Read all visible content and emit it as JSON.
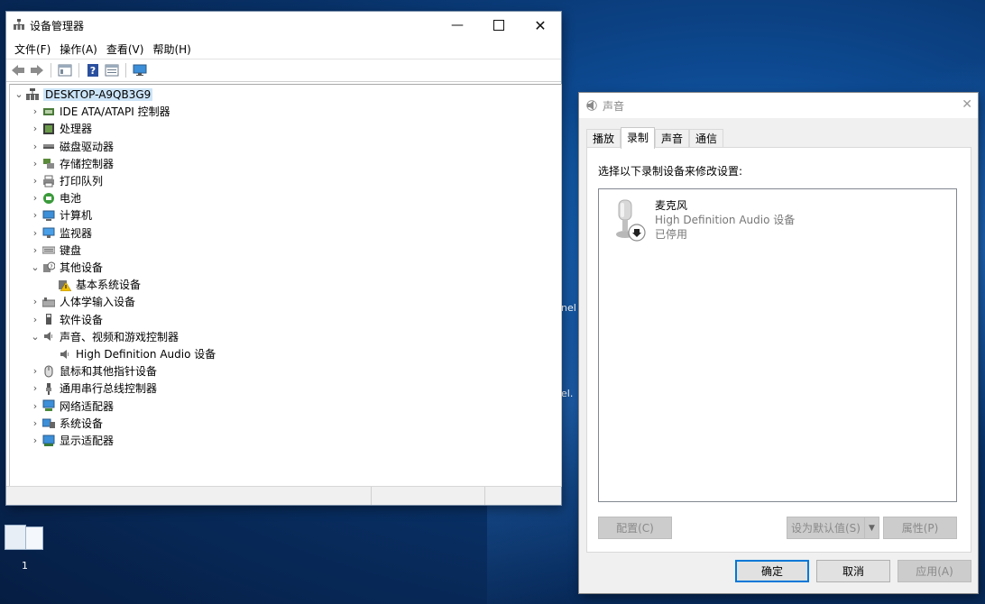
{
  "desktop": {
    "edge_text_1": "nel",
    "edge_text_2": "el.",
    "thumbnail_number": "1"
  },
  "device_manager": {
    "title": "设备管理器",
    "menu": [
      "文件(F)",
      "操作(A)",
      "查看(V)",
      "帮助(H)"
    ],
    "root": "DESKTOP-A9QB3G9",
    "tree": [
      {
        "label": "IDE ATA/ATAPI 控制器",
        "icon": "ide-controller-icon",
        "expanded": false,
        "level": 1
      },
      {
        "label": "处理器",
        "icon": "processor-icon",
        "expanded": false,
        "level": 1
      },
      {
        "label": "磁盘驱动器",
        "icon": "disk-drive-icon",
        "expanded": false,
        "level": 1
      },
      {
        "label": "存储控制器",
        "icon": "storage-controller-icon",
        "expanded": false,
        "level": 1
      },
      {
        "label": "打印队列",
        "icon": "printer-icon",
        "expanded": false,
        "level": 1
      },
      {
        "label": "电池",
        "icon": "battery-icon",
        "expanded": false,
        "level": 1
      },
      {
        "label": "计算机",
        "icon": "computer-icon",
        "expanded": false,
        "level": 1
      },
      {
        "label": "监视器",
        "icon": "monitor-icon",
        "expanded": false,
        "level": 1
      },
      {
        "label": "键盘",
        "icon": "keyboard-icon",
        "expanded": false,
        "level": 1
      },
      {
        "label": "其他设备",
        "icon": "other-devices-icon",
        "expanded": true,
        "level": 1
      },
      {
        "label": "基本系统设备",
        "icon": "warning-device-icon",
        "level": 2
      },
      {
        "label": "人体学输入设备",
        "icon": "hid-icon",
        "expanded": false,
        "level": 1
      },
      {
        "label": "软件设备",
        "icon": "software-device-icon",
        "expanded": false,
        "level": 1
      },
      {
        "label": "声音、视频和游戏控制器",
        "icon": "speaker-icon",
        "expanded": true,
        "level": 1
      },
      {
        "label": "High Definition Audio 设备",
        "icon": "speaker-icon",
        "level": 2
      },
      {
        "label": "鼠标和其他指针设备",
        "icon": "mouse-icon",
        "expanded": false,
        "level": 1
      },
      {
        "label": "通用串行总线控制器",
        "icon": "usb-icon",
        "expanded": false,
        "level": 1
      },
      {
        "label": "网络适配器",
        "icon": "network-adapter-icon",
        "expanded": false,
        "level": 1
      },
      {
        "label": "系统设备",
        "icon": "system-device-icon",
        "expanded": false,
        "level": 1
      },
      {
        "label": "显示适配器",
        "icon": "display-adapter-icon",
        "expanded": false,
        "level": 1
      }
    ]
  },
  "sound": {
    "title": "声音",
    "tabs": [
      "播放",
      "录制",
      "声音",
      "通信"
    ],
    "active_tab": "录制",
    "instruction": "选择以下录制设备来修改设置:",
    "device": {
      "name": "麦克风",
      "description": "High Definition Audio 设备",
      "status": "已停用"
    },
    "buttons": {
      "configure": "配置(C)",
      "set_default": "设为默认值(S)",
      "properties": "属性(P)",
      "ok": "确定",
      "cancel": "取消",
      "apply": "应用(A)"
    }
  }
}
